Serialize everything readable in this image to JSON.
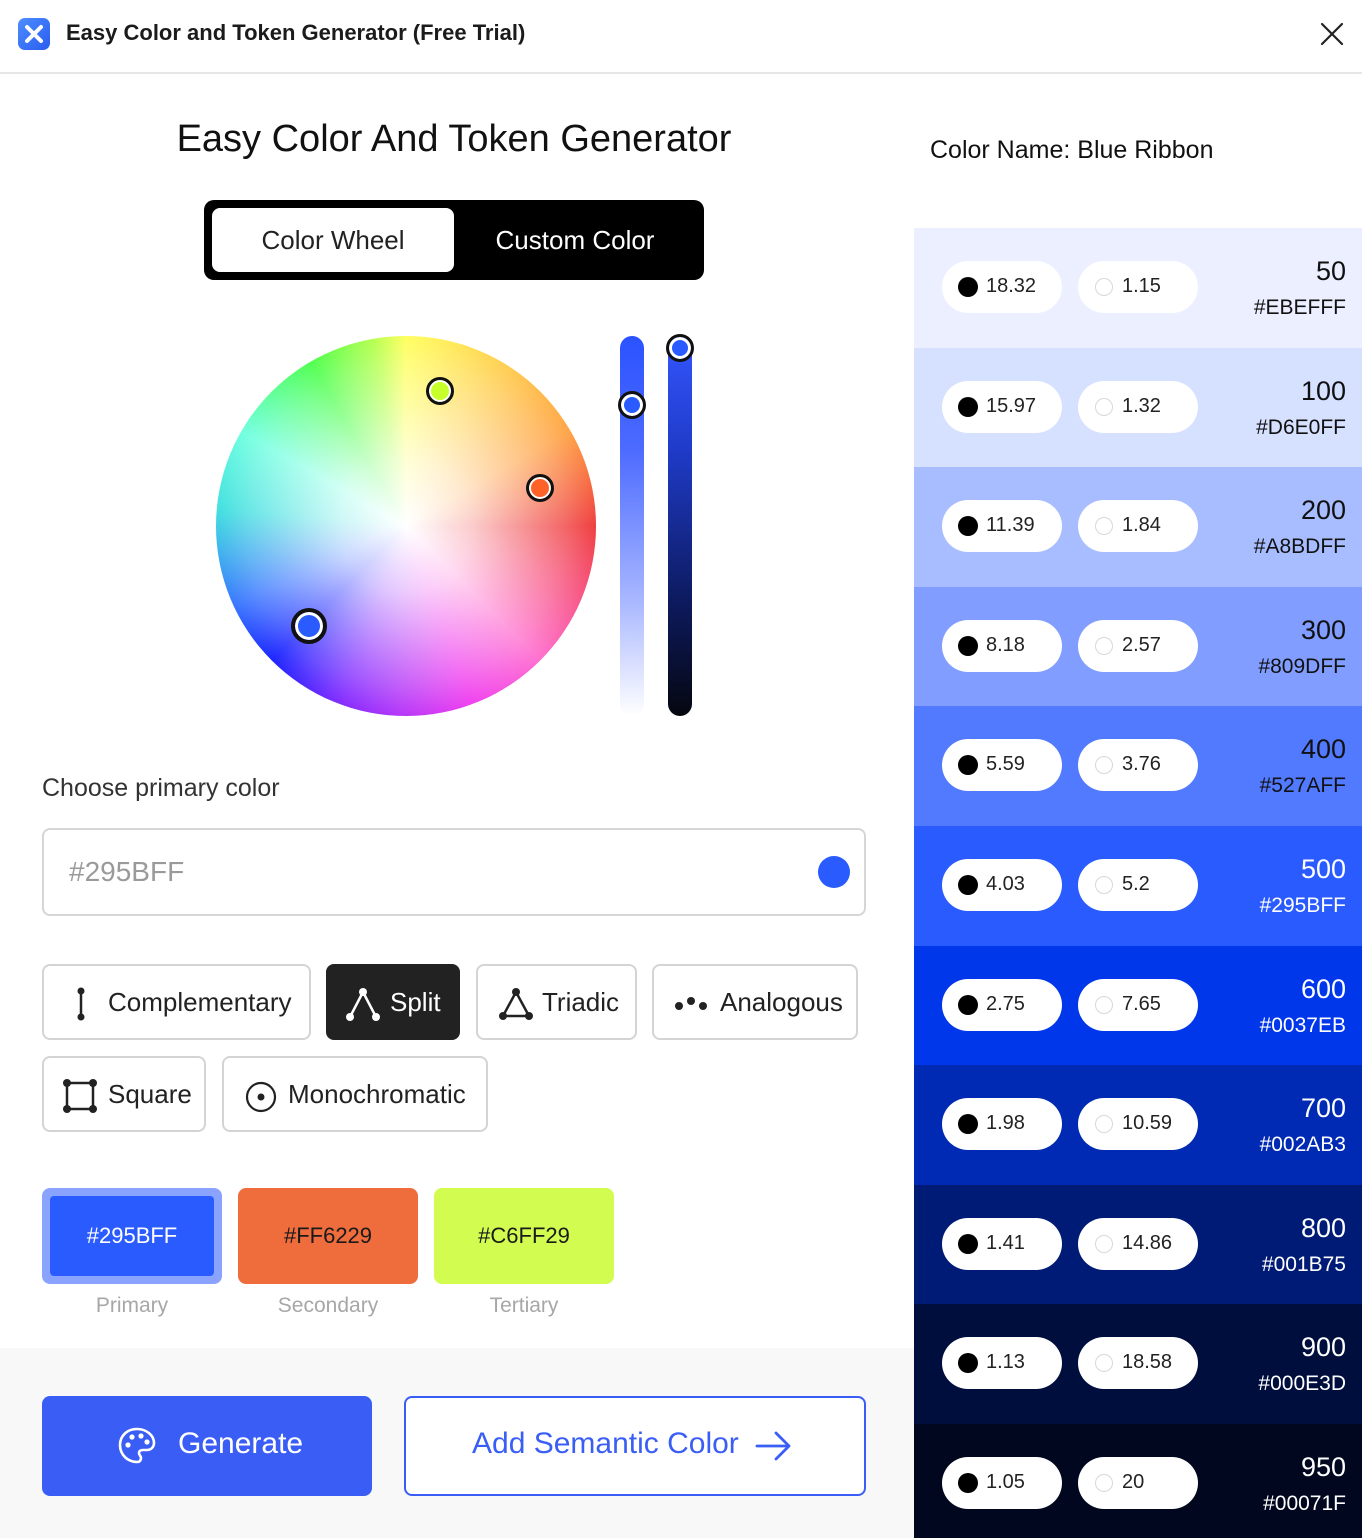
{
  "window": {
    "title": "Easy Color and Token Generator (Free Trial)"
  },
  "main": {
    "title": "Easy Color And Token Generator",
    "tabs": [
      "Color Wheel",
      "Custom Color"
    ],
    "active_tab": "Color Wheel",
    "choose_label": "Choose primary color",
    "hex_placeholder": "#295BFF",
    "primary_color": "#295BFF",
    "harmonies": [
      "Complementary",
      "Split",
      "Triadic",
      "Analogous",
      "Square",
      "Monochromatic"
    ],
    "selected_harmony": "Split",
    "swatches": [
      {
        "hex": "#295BFF",
        "label": "Primary",
        "color": "#295BFF"
      },
      {
        "hex": "#FF6229",
        "label": "Secondary",
        "color": "#FF6229"
      },
      {
        "hex": "#C6FF29",
        "label": "Tertiary",
        "color": "#C6FF29"
      }
    ],
    "generate_label": "Generate",
    "semantic_label": "Add Semantic Color"
  },
  "palette": {
    "color_name": "Color Name: Blue Ribbon",
    "shades": [
      {
        "step": "50",
        "hex": "#EBEFFF",
        "bg": "#EBEFFF",
        "text": "#111111",
        "black_contrast": "18.32",
        "white_contrast": "1.15"
      },
      {
        "step": "100",
        "hex": "#D6E0FF",
        "bg": "#D6E0FF",
        "text": "#111111",
        "black_contrast": "15.97",
        "white_contrast": "1.32"
      },
      {
        "step": "200",
        "hex": "#A8BDFF",
        "bg": "#A8BDFF",
        "text": "#111111",
        "black_contrast": "11.39",
        "white_contrast": "1.84"
      },
      {
        "step": "300",
        "hex": "#809DFF",
        "bg": "#809DFF",
        "text": "#111111",
        "black_contrast": "8.18",
        "white_contrast": "2.57"
      },
      {
        "step": "400",
        "hex": "#527AFF",
        "bg": "#527AFF",
        "text": "#111111",
        "black_contrast": "5.59",
        "white_contrast": "3.76"
      },
      {
        "step": "500",
        "hex": "#295BFF",
        "bg": "#295BFF",
        "text": "#FFFFFF",
        "black_contrast": "4.03",
        "white_contrast": "5.2"
      },
      {
        "step": "600",
        "hex": "#0037EB",
        "bg": "#0037EB",
        "text": "#FFFFFF",
        "black_contrast": "2.75",
        "white_contrast": "7.65"
      },
      {
        "step": "700",
        "hex": "#002AB3",
        "bg": "#002AB3",
        "text": "#FFFFFF",
        "black_contrast": "1.98",
        "white_contrast": "10.59"
      },
      {
        "step": "800",
        "hex": "#001B75",
        "bg": "#001B75",
        "text": "#FFFFFF",
        "black_contrast": "1.41",
        "white_contrast": "14.86"
      },
      {
        "step": "900",
        "hex": "#000E3D",
        "bg": "#000E3D",
        "text": "#FFFFFF",
        "black_contrast": "1.13",
        "white_contrast": "18.58"
      },
      {
        "step": "950",
        "hex": "#00071F",
        "bg": "#00071F",
        "text": "#FFFFFF",
        "black_contrast": "1.05",
        "white_contrast": "20"
      }
    ]
  }
}
